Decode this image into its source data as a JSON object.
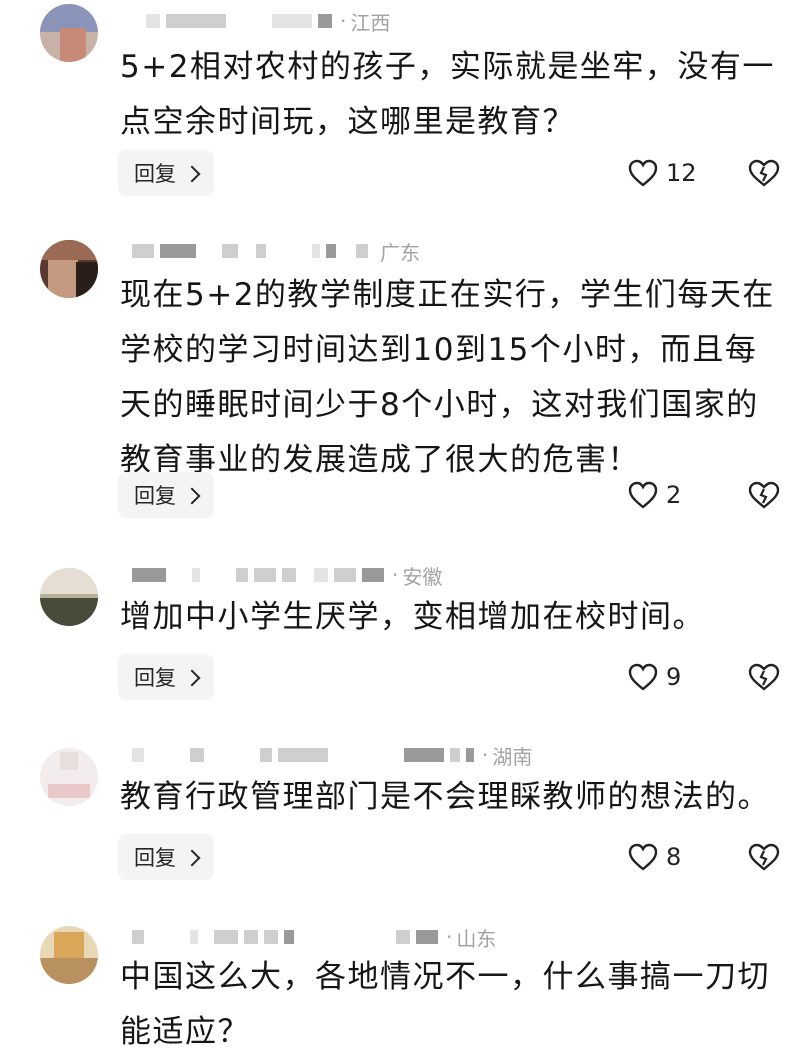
{
  "comments": [
    {
      "location": "江西",
      "text": "5+2相对农村的孩子，实际就是坐牢，没有一点空余时间玩，这哪里是教育？",
      "reply_label": "回复",
      "likes": "12",
      "avatar_colors": [
        "#8a93b8",
        "#c88a78",
        "#d9c2b0"
      ]
    },
    {
      "location": "广东",
      "text": "现在5+2的教学制度正在实行，学生们每天在学校的学习时间达到10到15个小时，而且每天的睡眠时间少于8个小时，这对我们国家的教育事业的发展造成了很大的危害！",
      "reply_label": "回复",
      "likes": "2",
      "avatar_colors": [
        "#7a4a38",
        "#3a2a22",
        "#c39a80"
      ]
    },
    {
      "location": "安徽",
      "text": "增加中小学生厌学，变相增加在校时间。",
      "reply_label": "回复",
      "likes": "9",
      "avatar_colors": [
        "#d8cfc2",
        "#4a4a3a",
        "#b5b09a"
      ]
    },
    {
      "location": "湖南",
      "text": "教育行政管理部门是不会理睬教师的想法的。",
      "reply_label": "回复",
      "likes": "8",
      "avatar_colors": [
        "#f1e6e6",
        "#e8c8c8",
        "#ffffff"
      ]
    },
    {
      "location": "山东",
      "text": "中国这么大，各地情况不一，什么事搞一刀切能适应？",
      "reply_label": "",
      "likes": "",
      "avatar_colors": [
        "#d9a65a",
        "#e9d8b5",
        "#b99060"
      ]
    }
  ]
}
